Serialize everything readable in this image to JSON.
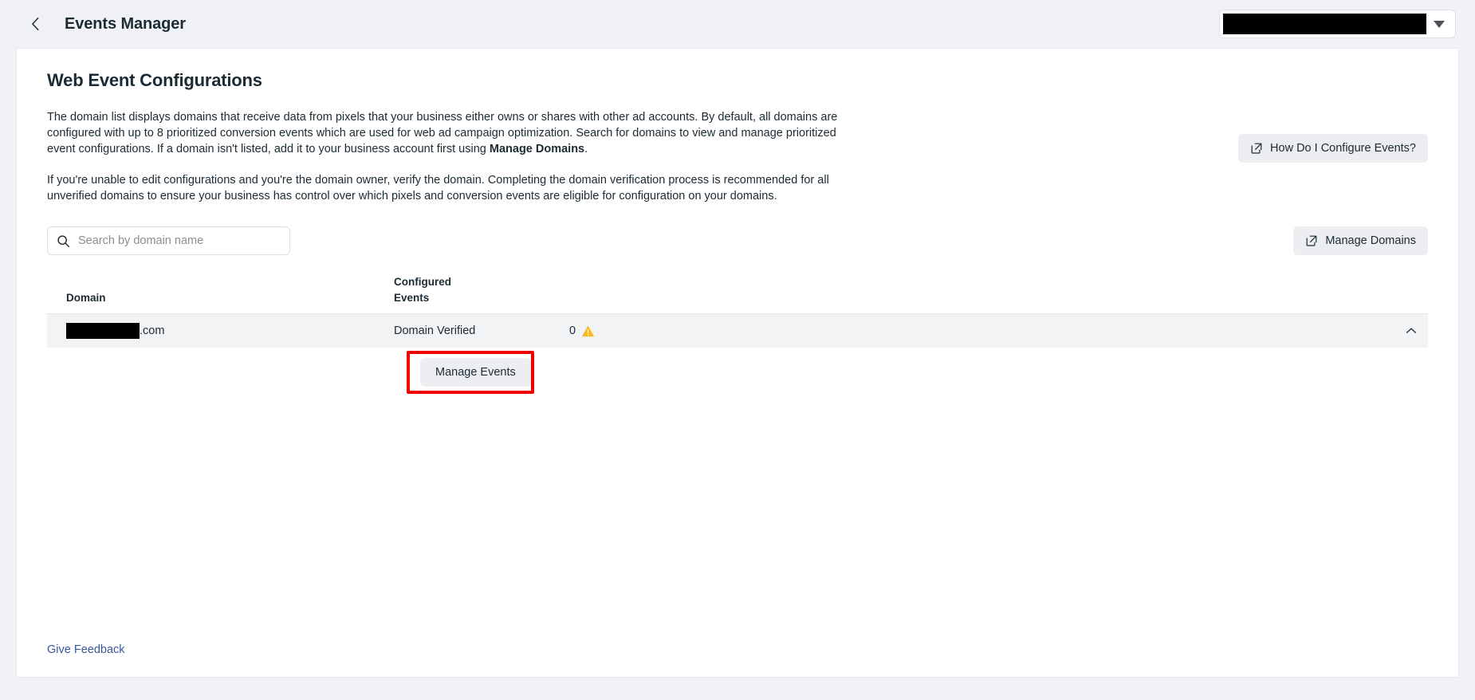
{
  "topbar": {
    "back_icon": "chevron-left-icon",
    "title": "Events Manager",
    "account_selector": {
      "value": "",
      "redacted": true,
      "caret_icon": "caret-down-icon"
    }
  },
  "page": {
    "title": "Web Event Configurations",
    "intro_paragraph_1_part1": "The domain list displays domains that receive data from pixels that your business either owns or shares with other ad accounts. By default, all domains are configured with up to 8 prioritized conversion events which are used for web ad campaign optimization. Search for domains to view and manage prioritized event configurations. If a domain isn't listed, add it to your business account first using ",
    "intro_paragraph_1_bold": "Manage Domains",
    "intro_paragraph_1_part2": ".",
    "intro_paragraph_2": "If you're unable to edit configurations and you're the domain owner, verify the domain. Completing the domain verification process is recommended for all unverified domains to ensure your business has control over which pixels and conversion events are eligible for configuration on your domains.",
    "help_button": {
      "label": "How Do I Configure Events?",
      "icon": "external-link-icon"
    }
  },
  "search": {
    "placeholder": "Search by domain name",
    "value": "",
    "icon": "search-icon"
  },
  "manage_domains_button": {
    "label": "Manage Domains",
    "icon": "external-link-icon"
  },
  "table": {
    "headers": {
      "domain": "Domain",
      "configured_events": "Configured\nEvents",
      "configured_events_line1": "Configured",
      "configured_events_line2": "Events"
    },
    "rows": [
      {
        "domain_redacted": true,
        "domain_suffix": ".com",
        "status": "Domain Verified",
        "configured_events_count": "0",
        "warning_icon": "warning-triangle-icon",
        "collapse_icon": "chevron-up-icon",
        "expanded": true,
        "manage_events_button": "Manage Events"
      }
    ]
  },
  "highlight": {
    "color": "#ee0000",
    "target": "manage-events-button"
  },
  "footer": {
    "give_feedback": "Give Feedback"
  },
  "colors": {
    "page_background": "#f0f2f5",
    "card_background": "#ffffff",
    "text_primary": "#1c2b33",
    "link": "#385898",
    "button_background": "#eceef1",
    "row_background": "#f2f3f5",
    "warning": "#f7b928",
    "highlight_red": "#ee0000"
  }
}
